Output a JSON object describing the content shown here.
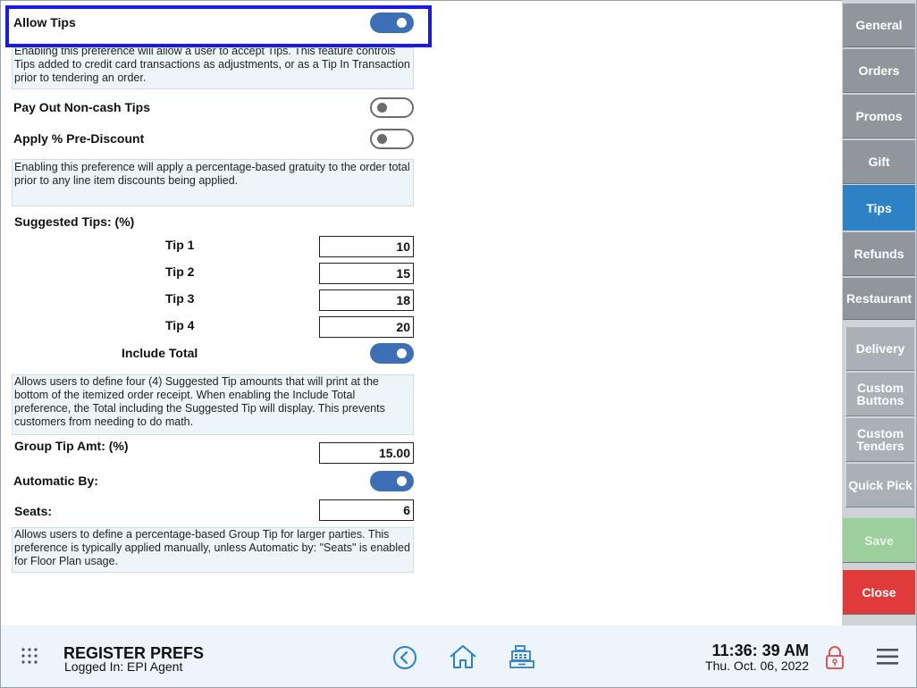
{
  "allow_tips": {
    "label": "Allow Tips",
    "enabled": true,
    "description": "Enabling this preference will allow a user to accept Tips. This feature controls Tips added to credit card transactions as adjustments, or as a Tip In Transaction prior to tendering an order."
  },
  "pay_out_noncash": {
    "label": "Pay Out Non-cash Tips",
    "enabled": false
  },
  "apply_pre_discount": {
    "label": "Apply % Pre-Discount",
    "enabled": false,
    "description": "Enabling this preference will apply a percentage-based gratuity to the order total prior to any line item discounts being applied."
  },
  "suggested_tips": {
    "heading": "Suggested Tips: (%)",
    "tips": [
      {
        "label": "Tip 1",
        "value": "10"
      },
      {
        "label": "Tip 2",
        "value": "15"
      },
      {
        "label": "Tip 3",
        "value": "18"
      },
      {
        "label": "Tip 4",
        "value": "20"
      }
    ],
    "include_total_label": "Include Total",
    "include_total_enabled": true,
    "description": "Allows users to define four (4) Suggested Tip amounts that will print at the bottom of the itemized order receipt. When enabling the Include Total preference, the Total including the Suggested Tip will display. This prevents customers from needing to do math."
  },
  "group_tip": {
    "amount_label": "Group Tip Amt: (%)",
    "amount_value": "15.00",
    "automatic_by_label": "Automatic By:",
    "automatic_by_enabled": true,
    "seats_label": "Seats:",
    "seats_value": "6",
    "description": "Allows users to define a percentage-based Group Tip for larger parties. This preference is typically applied manually, unless Automatic by: \"Seats\" is enabled for Floor Plan usage."
  },
  "tabs": {
    "general": "General",
    "orders": "Orders",
    "promos": "Promos",
    "gift": "Gift",
    "tips": "Tips",
    "refunds": "Refunds",
    "restaurant": "Restaurant",
    "delivery": "Delivery",
    "custom_buttons": "Custom Buttons",
    "custom_tenders": "Custom Tenders",
    "quick_pick": "Quick Pick",
    "save": "Save",
    "close": "Close"
  },
  "footer": {
    "title": "REGISTER PREFS",
    "logged_in": "Logged In:  EPI Agent",
    "time": "11:36: 39 AM",
    "date": "Thu. Oct. 06, 2022"
  },
  "colors": {
    "active_tab": "#2c82c4",
    "toggle_on": "#3d6fb6",
    "save_disabled": "#9ccf9d",
    "close": "#e03a3a",
    "highlight_border": "#1a1ae6"
  },
  "icons": [
    "grid-menu-icon",
    "back-icon",
    "home-icon",
    "register-icon",
    "lock-icon",
    "hamburger-menu-icon"
  ]
}
